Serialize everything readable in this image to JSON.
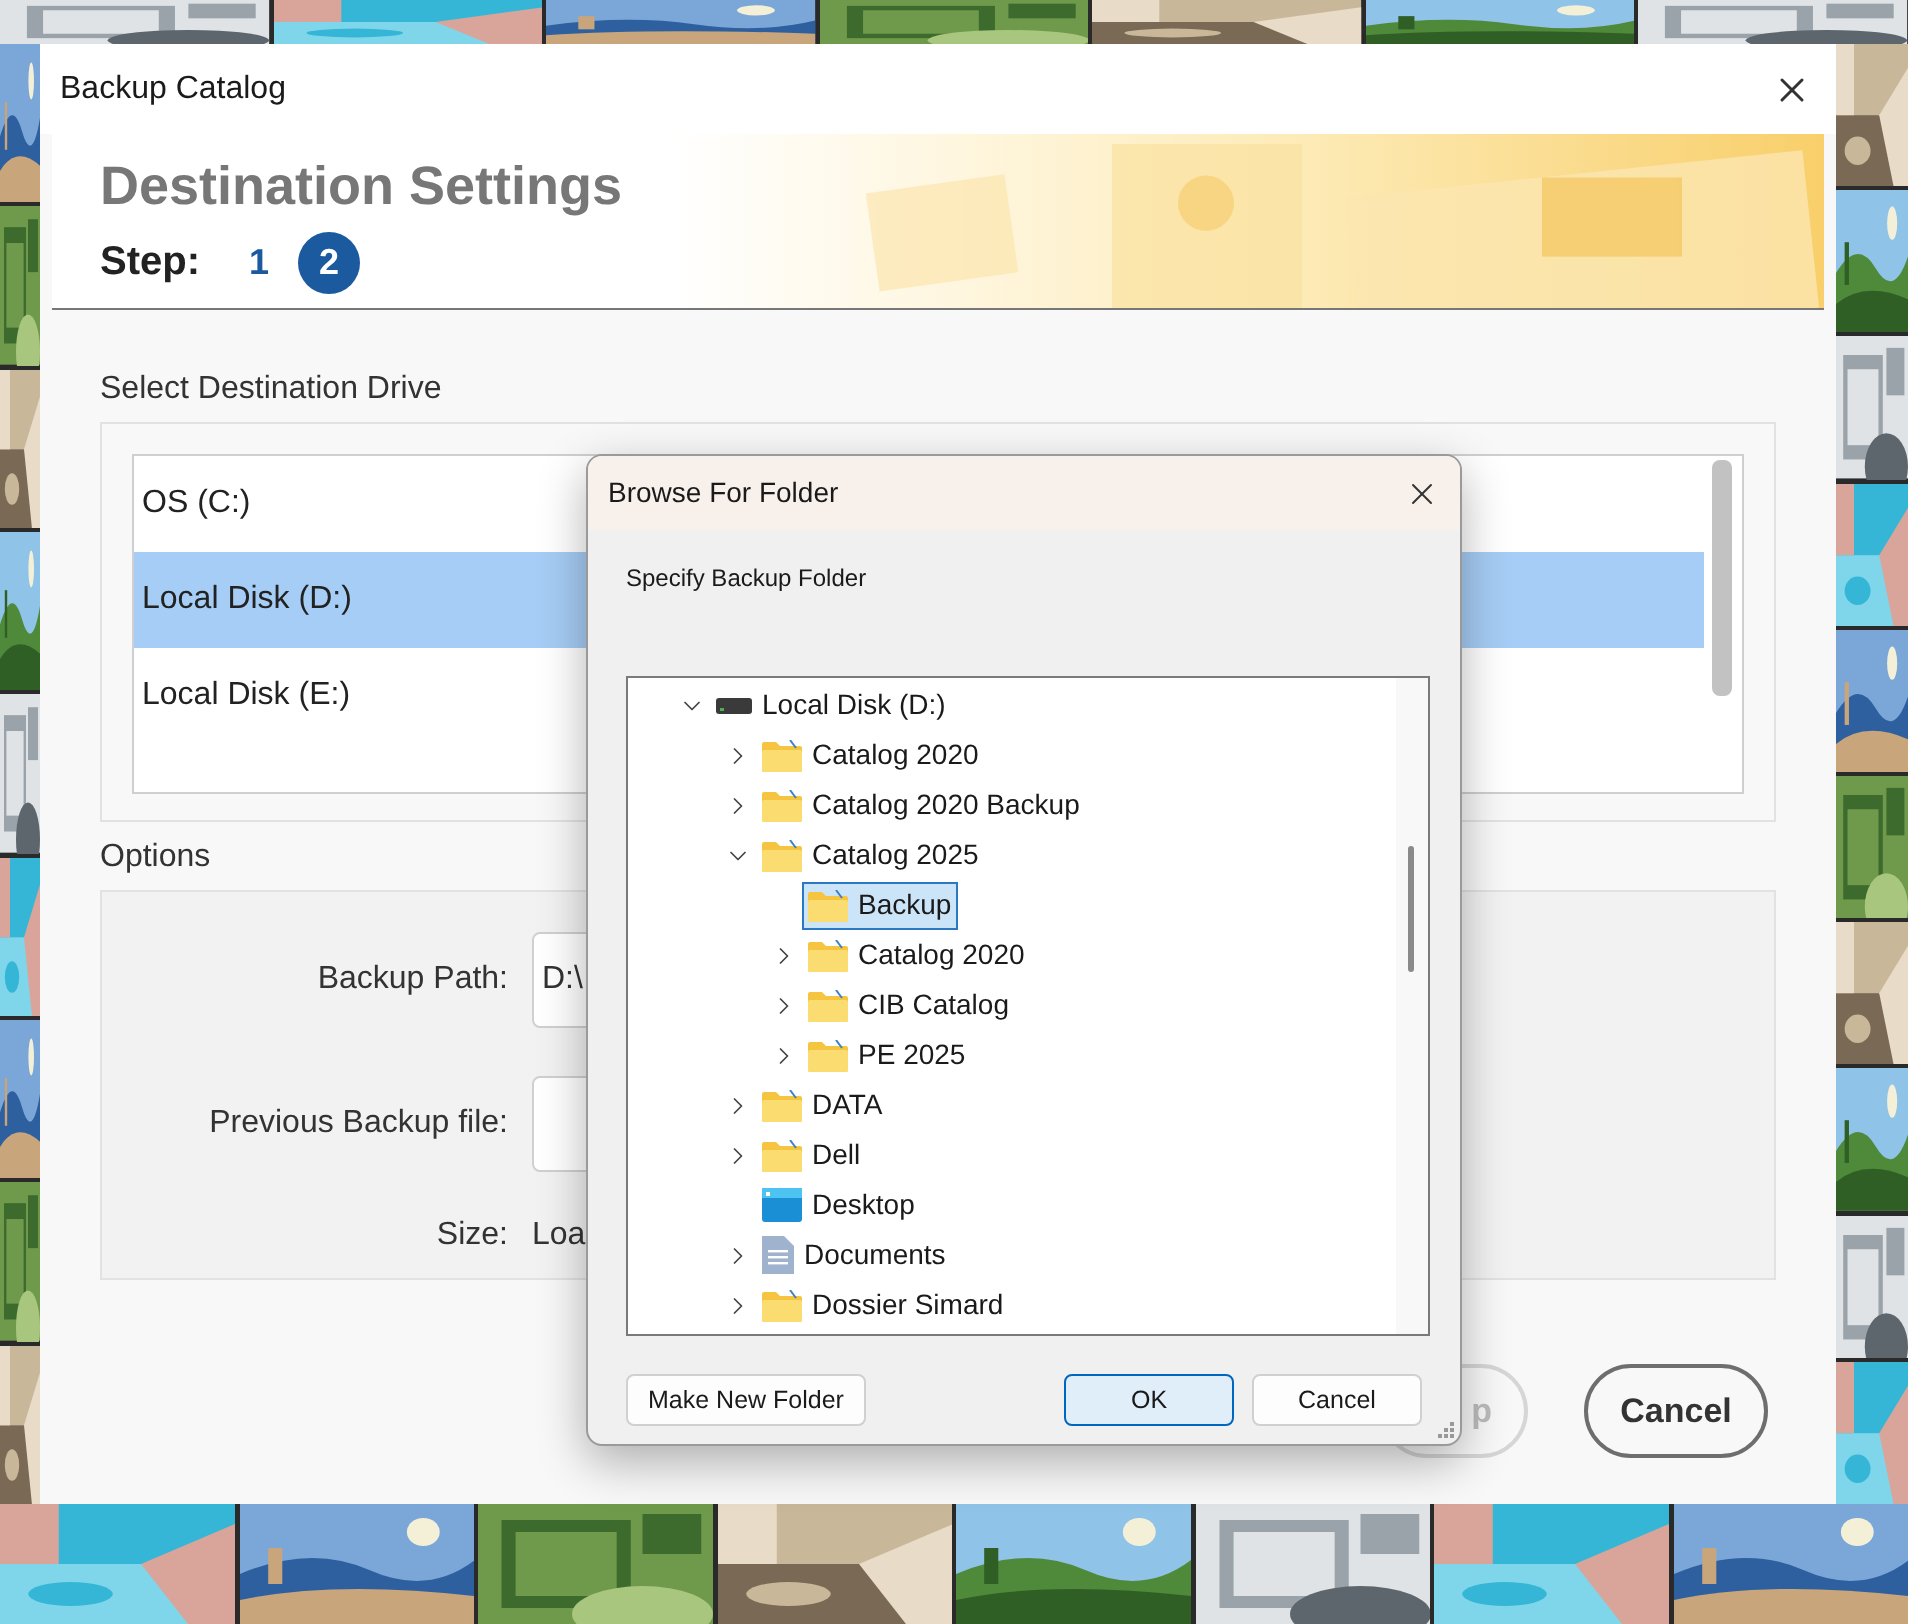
{
  "window": {
    "title": "Backup Catalog"
  },
  "header": {
    "title": "Destination Settings",
    "step_label": "Step:",
    "steps": [
      {
        "label": "1",
        "selected": false
      },
      {
        "label": "2",
        "selected": true
      }
    ]
  },
  "drive_section": {
    "label": "Select Destination Drive",
    "drives": [
      {
        "label": "OS (C:)",
        "selected": false
      },
      {
        "label": "Local Disk (D:)",
        "selected": true
      },
      {
        "label": "Local Disk (E:)",
        "selected": false
      }
    ]
  },
  "options": {
    "label": "Options",
    "backup_path": {
      "label": "Backup Path:",
      "value": "D:\\"
    },
    "previous_backup": {
      "label": "Previous Backup file:"
    },
    "size": {
      "label": "Size:",
      "value": "Loa"
    }
  },
  "buttons": [
    {
      "label": "p",
      "kind": "secondary"
    },
    {
      "label": "Cancel",
      "kind": "primary"
    }
  ],
  "browse_dialog": {
    "title": "Browse For Folder",
    "prompt": "Specify Backup Folder",
    "tree": [
      {
        "label": "Local Disk (D:)",
        "kind": "drive",
        "expandable": true,
        "expanded": true,
        "selected": false,
        "children": [
          {
            "label": "Catalog 2020",
            "kind": "folder",
            "expandable": true,
            "expanded": false,
            "selected": false
          },
          {
            "label": "Catalog 2020 Backup",
            "kind": "folder",
            "expandable": true,
            "expanded": false,
            "selected": false
          },
          {
            "label": "Catalog 2025",
            "kind": "folder",
            "expandable": true,
            "expanded": true,
            "selected": false,
            "children": [
              {
                "label": "Backup",
                "kind": "folder",
                "expandable": false,
                "selected": true
              },
              {
                "label": "Catalog 2020",
                "kind": "folder",
                "expandable": true,
                "expanded": false,
                "selected": false
              },
              {
                "label": "CIB Catalog",
                "kind": "folder",
                "expandable": true,
                "expanded": false,
                "selected": false
              },
              {
                "label": "PE 2025",
                "kind": "folder",
                "expandable": true,
                "expanded": false,
                "selected": false
              }
            ]
          },
          {
            "label": "DATA",
            "kind": "folder",
            "expandable": true,
            "expanded": false,
            "selected": false
          },
          {
            "label": "Dell",
            "kind": "folder",
            "expandable": true,
            "expanded": false,
            "selected": false
          },
          {
            "label": "Desktop",
            "kind": "desktop",
            "expandable": false,
            "selected": false
          },
          {
            "label": "Documents",
            "kind": "document",
            "expandable": true,
            "expanded": false,
            "selected": false
          },
          {
            "label": "Dossier Simard",
            "kind": "folder",
            "expandable": true,
            "expanded": false,
            "selected": false
          }
        ]
      }
    ],
    "buttons": [
      {
        "label": "Make New Folder",
        "kind": "secondary"
      },
      {
        "label": "OK",
        "kind": "default"
      },
      {
        "label": "Cancel",
        "kind": "secondary"
      }
    ]
  }
}
